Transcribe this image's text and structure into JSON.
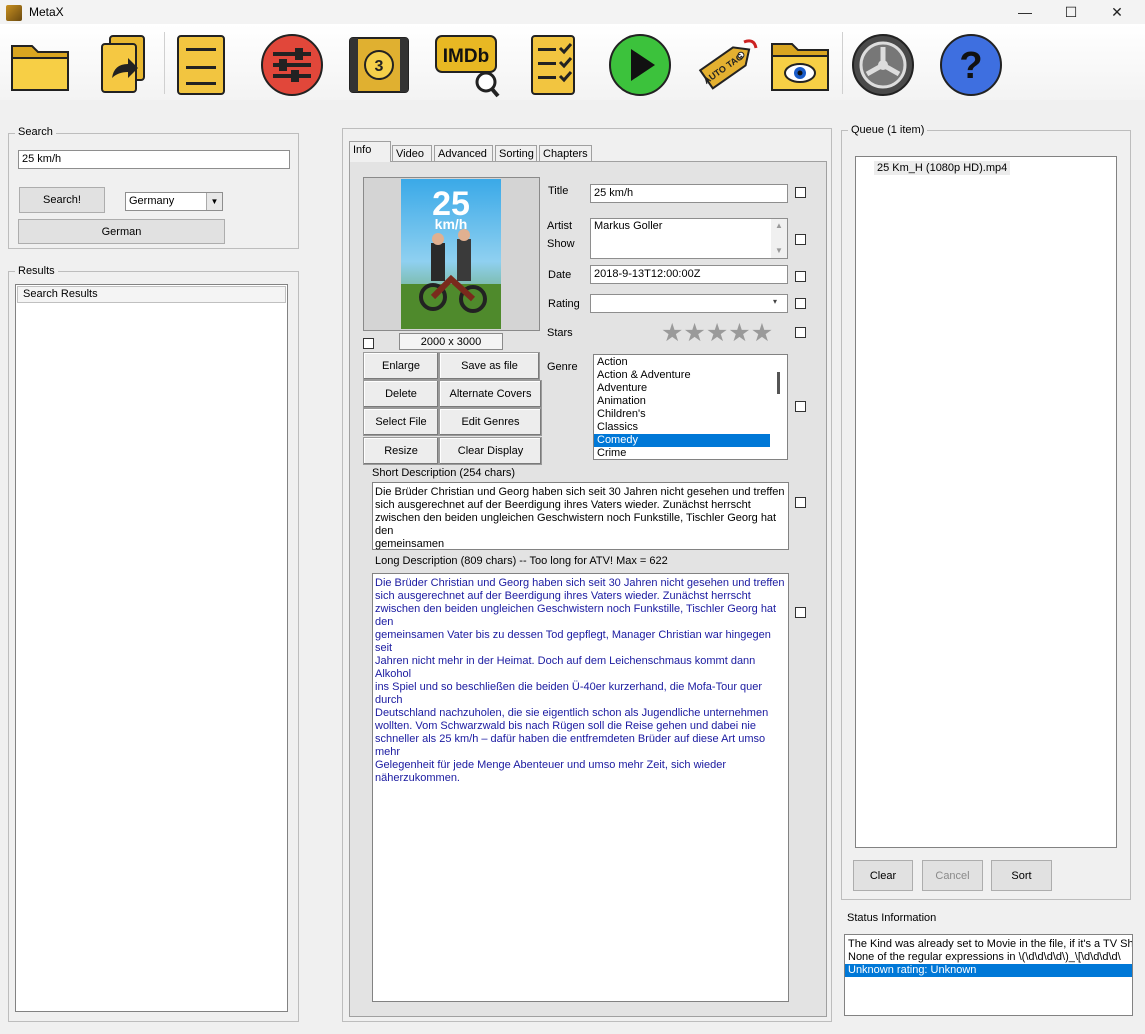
{
  "window": {
    "title": "MetaX",
    "minimize_glyph": "—",
    "maximize_glyph": "☐",
    "close_glyph": "✕"
  },
  "toolbar": {
    "icons": [
      "open-folder-icon",
      "batch-files-icon",
      "file-cabinet-icon",
      "settings-sliders-icon",
      "film-reel-icon",
      "imdb-search-icon",
      "checklist-icon",
      "play-icon",
      "auto-tag-icon",
      "view-folder-icon",
      "film-projector-icon",
      "help-icon"
    ],
    "imdb_text": "IMDb",
    "film_number": "3",
    "auto_tag_text": "AUTO TAG",
    "help_glyph": "?"
  },
  "search": {
    "group_title": "Search",
    "query": "25 km/h",
    "search_button": "Search!",
    "country": "Germany",
    "language_button": "German"
  },
  "results": {
    "group_title": "Results",
    "column_header": "Search Results"
  },
  "tabs": [
    "Info",
    "Video",
    "Advanced",
    "Sorting",
    "Chapters"
  ],
  "cover": {
    "title_number": "25",
    "title_unit": "km/h",
    "dimensions": "2000 x 3000"
  },
  "cover_buttons": {
    "enlarge": "Enlarge",
    "save_as_file": "Save as file",
    "delete": "Delete",
    "alternate_covers": "Alternate Covers",
    "select_file": "Select File",
    "edit_genres": "Edit Genres",
    "resize": "Resize",
    "clear_display": "Clear Display"
  },
  "fields": {
    "title_label": "Title",
    "title_value": "25 km/h",
    "artist_label": "Artist",
    "show_label": "Show",
    "artist_value": "Markus Goller",
    "date_label": "Date",
    "date_value": "2018-9-13T12:00:00Z",
    "rating_label": "Rating",
    "rating_value": "",
    "stars_label": "Stars",
    "stars_value": 0,
    "genre_label": "Genre"
  },
  "genres": {
    "items": [
      "Action",
      "Action & Adventure",
      "Adventure",
      "Animation",
      "Children's",
      "Classics",
      "Comedy",
      "Crime"
    ],
    "selected": "Comedy"
  },
  "short_description": {
    "label": "Short Description (254 chars)",
    "text": "Die Brüder Christian und Georg haben sich seit 30 Jahren nicht gesehen und treffen\nsich ausgerechnet auf der Beerdigung ihres Vaters wieder. Zunächst herrscht\nzwischen den beiden ungleichen Geschwistern noch Funkstille, Tischler Georg hat den\ngemeinsamen"
  },
  "long_description": {
    "label": "Long Description (809 chars)  -- Too long for ATV! Max = 622",
    "text": "Die Brüder Christian und Georg haben sich seit 30 Jahren nicht gesehen und treffen\nsich ausgerechnet auf der Beerdigung ihres Vaters wieder. Zunächst herrscht\nzwischen den beiden ungleichen Geschwistern noch Funkstille, Tischler Georg hat den\ngemeinsamen Vater bis zu dessen Tod gepflegt, Manager Christian war hingegen seit\nJahren nicht mehr in der Heimat. Doch auf dem Leichenschmaus kommt dann Alkohol\nins Spiel und so beschließen die beiden Ü-40er kurzerhand, die Mofa-Tour quer durch\nDeutschland nachzuholen, die sie eigentlich schon als Jugendliche unternehmen\nwollten. Vom Schwarzwald bis nach Rügen soll die Reise gehen und dabei nie\nschneller als 25 km/h – dafür haben die entfremdeten Brüder auf diese Art umso mehr\nGelegenheit für jede Menge Abenteuer und umso mehr Zeit, sich wieder\nnäherzukommen.",
    "text_color": "#1a1aa0"
  },
  "queue": {
    "group_title": "Queue (1 item)",
    "items": [
      "25 Km_H (1080p HD).mp4"
    ],
    "clear_button": "Clear",
    "cancel_button": "Cancel",
    "sort_button": "Sort"
  },
  "status": {
    "title": "Status Information",
    "lines": [
      "The Kind was already set to Movie in the file, if it's a TV Show",
      "None of the regular expressions in \\(\\d\\d\\d\\d\\)_\\[\\d\\d\\d\\d\\",
      "Unknown rating: Unknown"
    ],
    "selected_index": 2
  },
  "colors": {
    "selection": "#0078d7",
    "window_bg": "#f0f0f0"
  }
}
